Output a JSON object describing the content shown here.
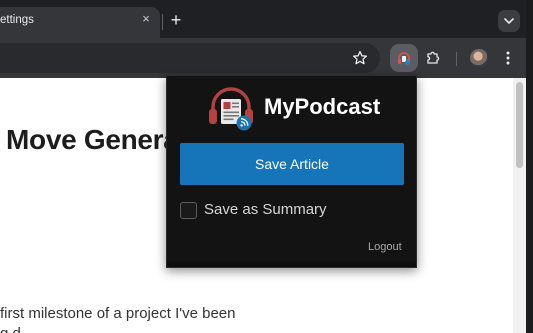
{
  "tab": {
    "title": "ettings",
    "close_glyph": "×",
    "new_tab_glyph": "+"
  },
  "page": {
    "headline": "Move Genera",
    "body_lines": [
      "first milestone of a project I've been",
      "g                            d"
    ]
  },
  "popup": {
    "brand": "MyPodcast",
    "save_button_label": "Save Article",
    "summary_label": "Save as Summary",
    "summary_checked": false,
    "logout_label": "Logout",
    "colors": {
      "accent": "#1675b8",
      "logo_red": "#b4423f",
      "logo_blue": "#1c73b4",
      "background": "#131313"
    }
  },
  "icons": {
    "toolbar": [
      "star-icon",
      "mypodcast-extension-icon",
      "extensions-puzzle-icon",
      "profile-avatar",
      "kebab-menu-icon"
    ],
    "tabstrip": [
      "tab-search-chevron-icon"
    ]
  }
}
